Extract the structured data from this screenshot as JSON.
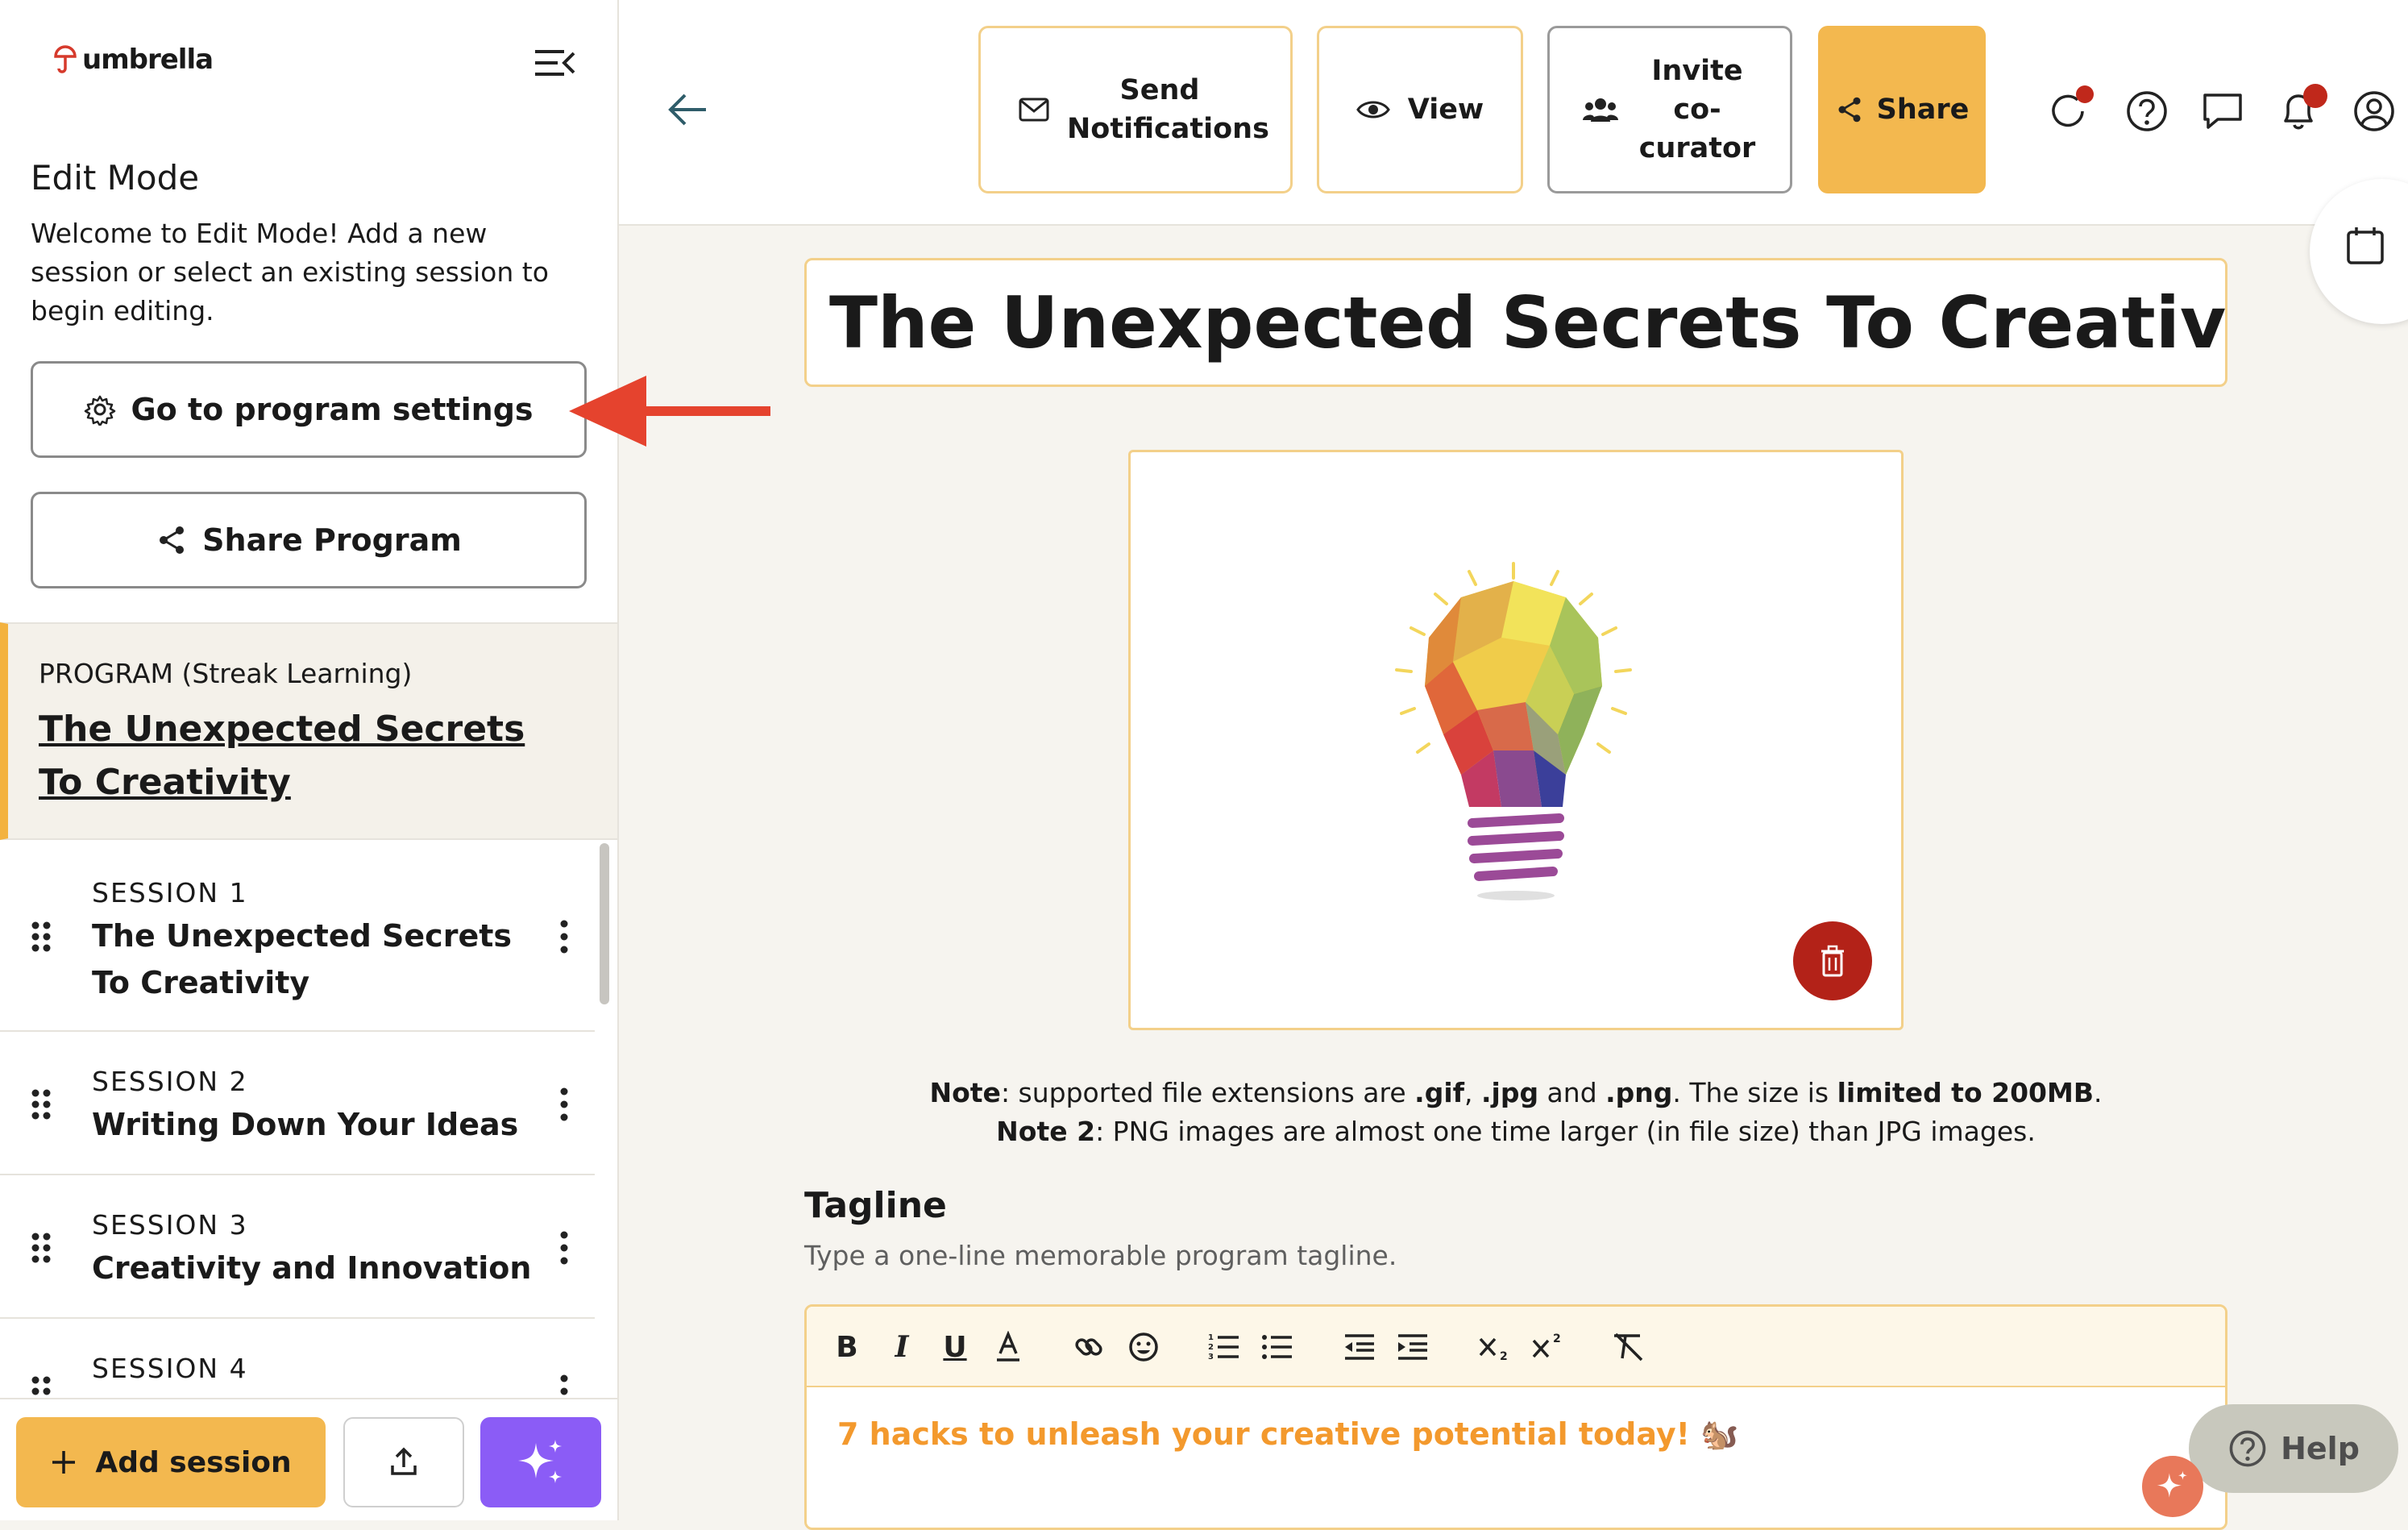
{
  "app": {
    "logo_text": "umbrella"
  },
  "sidebar": {
    "edit_title": "Edit Mode",
    "edit_description": "Welcome to Edit Mode! Add a new session or select an existing session to begin editing.",
    "settings_button": "Go to program settings",
    "share_program_button": "Share Program",
    "program": {
      "type_label": "PROGRAM (Streak Learning)",
      "name": "The Unexpected Secrets To Creativity"
    },
    "sessions": [
      {
        "number": "SESSION 1",
        "title": "The Unexpected Secrets To Creativity"
      },
      {
        "number": "SESSION 2",
        "title": "Writing Down Your Ideas"
      },
      {
        "number": "SESSION 3",
        "title": "Creativity and Innovation"
      },
      {
        "number": "SESSION 4",
        "title": ""
      }
    ],
    "add_session_button": "Add session"
  },
  "topbar": {
    "send_notifications": "Send Notifications",
    "view": "View",
    "invite_cocurator": "Invite co-curator",
    "share": "Share"
  },
  "main": {
    "program_title": "The Unexpected Secrets To Creativity",
    "note1": {
      "label": "Note",
      "text_a": ": supported file extensions are ",
      "ext1": ".gif",
      "sep1": ", ",
      "ext2": ".jpg",
      "sep2": " and ",
      "ext3": ".png",
      "text_b": ". The size is ",
      "limit": "limited to 200MB",
      "end": "."
    },
    "note2": {
      "label": "Note 2",
      "text": ": PNG images are almost one time larger (in file size) than JPG images."
    },
    "tagline_label": "Tagline",
    "tagline_description": "Type a one-line memorable program tagline.",
    "tagline_value": "7 hacks to unleash your creative potential today! 🐿️",
    "help_button": "Help"
  },
  "colors": {
    "accent": "#f3b84f",
    "accent_border": "#f3d08a",
    "danger": "#b32218",
    "ai_purple": "#8b5cf6",
    "tagline_text": "#f3992d"
  }
}
